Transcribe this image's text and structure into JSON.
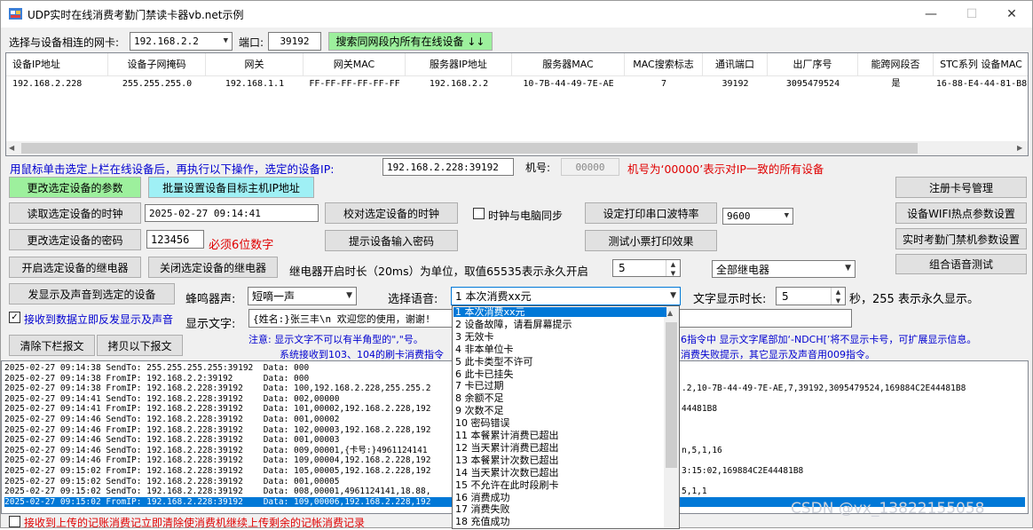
{
  "window": {
    "title": "UDP实时在线消费考勤门禁读卡器vb.net示例",
    "minimize": "—",
    "maximize": "☐",
    "close": "✕"
  },
  "top": {
    "nic_label": "选择与设备相连的网卡:",
    "nic_value": "192.168.2.2",
    "port_label": "端口:",
    "port_value": "39192",
    "search_button": "搜索同网段内所有在线设备 ↓↓"
  },
  "device_table": {
    "headers": [
      "设备IP地址",
      "设备子网掩码",
      "网关",
      "网关MAC",
      "服务器IP地址",
      "服务器MAC",
      "MAC搜索标志",
      "通讯端口",
      "出厂序号",
      "能跨网段否",
      "STC系列 设备MAC"
    ],
    "row": [
      "192.168.2.228",
      "255.255.255.0",
      "192.168.1.1",
      "FF-FF-FF-FF-FF-FF",
      "192.168.2.2",
      "10-7B-44-49-7E-AE",
      "7",
      "39192",
      "3095479524",
      "是",
      "16-88-E4-44-81-B8"
    ]
  },
  "selected": {
    "hint": "用鼠标单击选定上栏在线设备后，再执行以下操作，选定的设备IP:",
    "ip_value": "192.168.2.228:39192",
    "machine_label": "机号:",
    "machine_value": "00000",
    "machine_note": "机号为‘00000’表示对IP一致的所有设备"
  },
  "buttons": {
    "modify_params": "更改选定设备的参数",
    "batch_ip": "批量设置设备目标主机IP地址",
    "read_clock": "读取选定设备的时钟",
    "sync_clock": "校对选定设备的时钟",
    "modify_pwd": "更改选定设备的密码",
    "prompt_pwd": "提示设备输入密码",
    "open_relay": "开启选定设备的继电器",
    "close_relay": "关闭选定设备的继电器",
    "set_baud": "设定打印串口波特率",
    "test_print": "测试小票打印效果",
    "register_card": "注册卡号管理",
    "wifi_params": "设备WIFI热点参数设置",
    "attendance_params": "实时考勤门禁机参数设置",
    "voice_test": "组合语音测试",
    "send_display": "发显示及声音到选定的设备",
    "clear_log": "清除下栏报文",
    "copy_log": "拷贝以下报文"
  },
  "clock_value": "2025-02-27 09:14:41",
  "clock_sync_label": "时钟与电脑同步",
  "password_value": "123456",
  "password_note": "必须6位数字",
  "baud_value": "9600",
  "relay_label": "继电器开启时长（20ms）为单位，取值65535表示永久开启",
  "relay_value": "5",
  "relay_select": "全部继电器",
  "buzzer_label": "蜂鸣器声:",
  "buzzer_value": "短嘀一声",
  "voice_label": "选择语音:",
  "voice_value": "1  本次消费xx元",
  "display_time_label": "文字显示时长:",
  "display_time_value": "5",
  "display_time_note": "秒，255 表示永久显示。",
  "auto_reply_label": "接收到数据立即反发显示及声音",
  "display_text_label": "显示文字:",
  "display_text_value": "{姓名:}张三丰\\n    欢迎您的使用，谢谢!",
  "note1_a": "注意: 显示文字不可以有半角型的\",\"号。",
  "note1_b": "6指令中 显示文字尾部加‘-NDCH[’将不显示卡号，可扩展显示信息。",
  "note2_a": "系统接收到103、104的刷卡消费指令",
  "note2_b": "消费失败提示，其它显示及声音用009指令。",
  "log_lines": [
    "2025-02-27 09:14:38 SendTo: 255.255.255.255:39192  Data: 000",
    "2025-02-27 09:14:38 FromIP: 192.168.2.2:39192      Data: 000",
    "2025-02-27 09:14:38 FromIP: 192.168.2.228:39192    Data: 100,192.168.2.228,255.255.2",
    "2025-02-27 09:14:41 SendTo: 192.168.2.228:39192    Data: 002,00000",
    "2025-02-27 09:14:41 FromIP: 192.168.2.228:39192    Data: 101,00002,192.168.2.228,192",
    "2025-02-27 09:14:46 SendTo: 192.168.2.228:39192    Data: 001,00002",
    "2025-02-27 09:14:46 FromIP: 192.168.2.228:39192    Data: 102,00003,192.168.2.228,192",
    "2025-02-27 09:14:46 SendTo: 192.168.2.228:39192    Data: 001,00003",
    "2025-02-27 09:14:46 SendTo: 192.168.2.228:39192    Data: 009,00001,{卡号:}4961124141",
    "2025-02-27 09:14:46 FromIP: 192.168.2.228:39192    Data: 109,00004,192.168.2.228,192",
    "2025-02-27 09:15:02 FromIP: 192.168.2.228:39192    Data: 105,00005,192.168.2.228,192",
    "2025-02-27 09:15:02 SendTo: 192.168.2.228:39192    Data: 001,00005",
    "2025-02-27 09:15:02 SendTo: 192.168.2.228:39192    Data: 008,00001,4961124141,18.88,",
    "2025-02-27 09:15:02 FromIP: 192.168.2.228:39192    Data: 109,00006,192.168.2.228,192"
  ],
  "log_tails": [
    {
      "row": 2,
      "text": ".2,10-7B-44-49-7E-AE,7,39192,3095479524,169884C2E44481B8"
    },
    {
      "row": 4,
      "text": "44481B8"
    },
    {
      "row": 8,
      "text": "n,5,1,16"
    },
    {
      "row": 10,
      "text": "3:15:02,169884C2E44481B8"
    },
    {
      "row": 12,
      "text": "5,1,1"
    }
  ],
  "bottom_check_label": "接收到上传的记账消费记立即清除使消费机继续上传剩余的记帐消费记录",
  "voice_options": [
    "1  本次消费xx元",
    "2  设备故障，请看屏幕提示",
    "3  无效卡",
    "4  非本单位卡",
    "5  此卡类型不许可",
    "6  此卡已挂失",
    "7  卡已过期",
    "8  余额不足",
    "9  次数不足",
    "10 密码错误",
    "11 本餐累计消费已超出",
    "12 当天累计消费已超出",
    "13 本餐累计次数已超出",
    "14 当天累计次数已超出",
    "15 不允许在此时段刷卡",
    "16 消费成功",
    "17 消费失败",
    "18 充值成功"
  ],
  "watermark": "CSDN @vx_13822155058"
}
